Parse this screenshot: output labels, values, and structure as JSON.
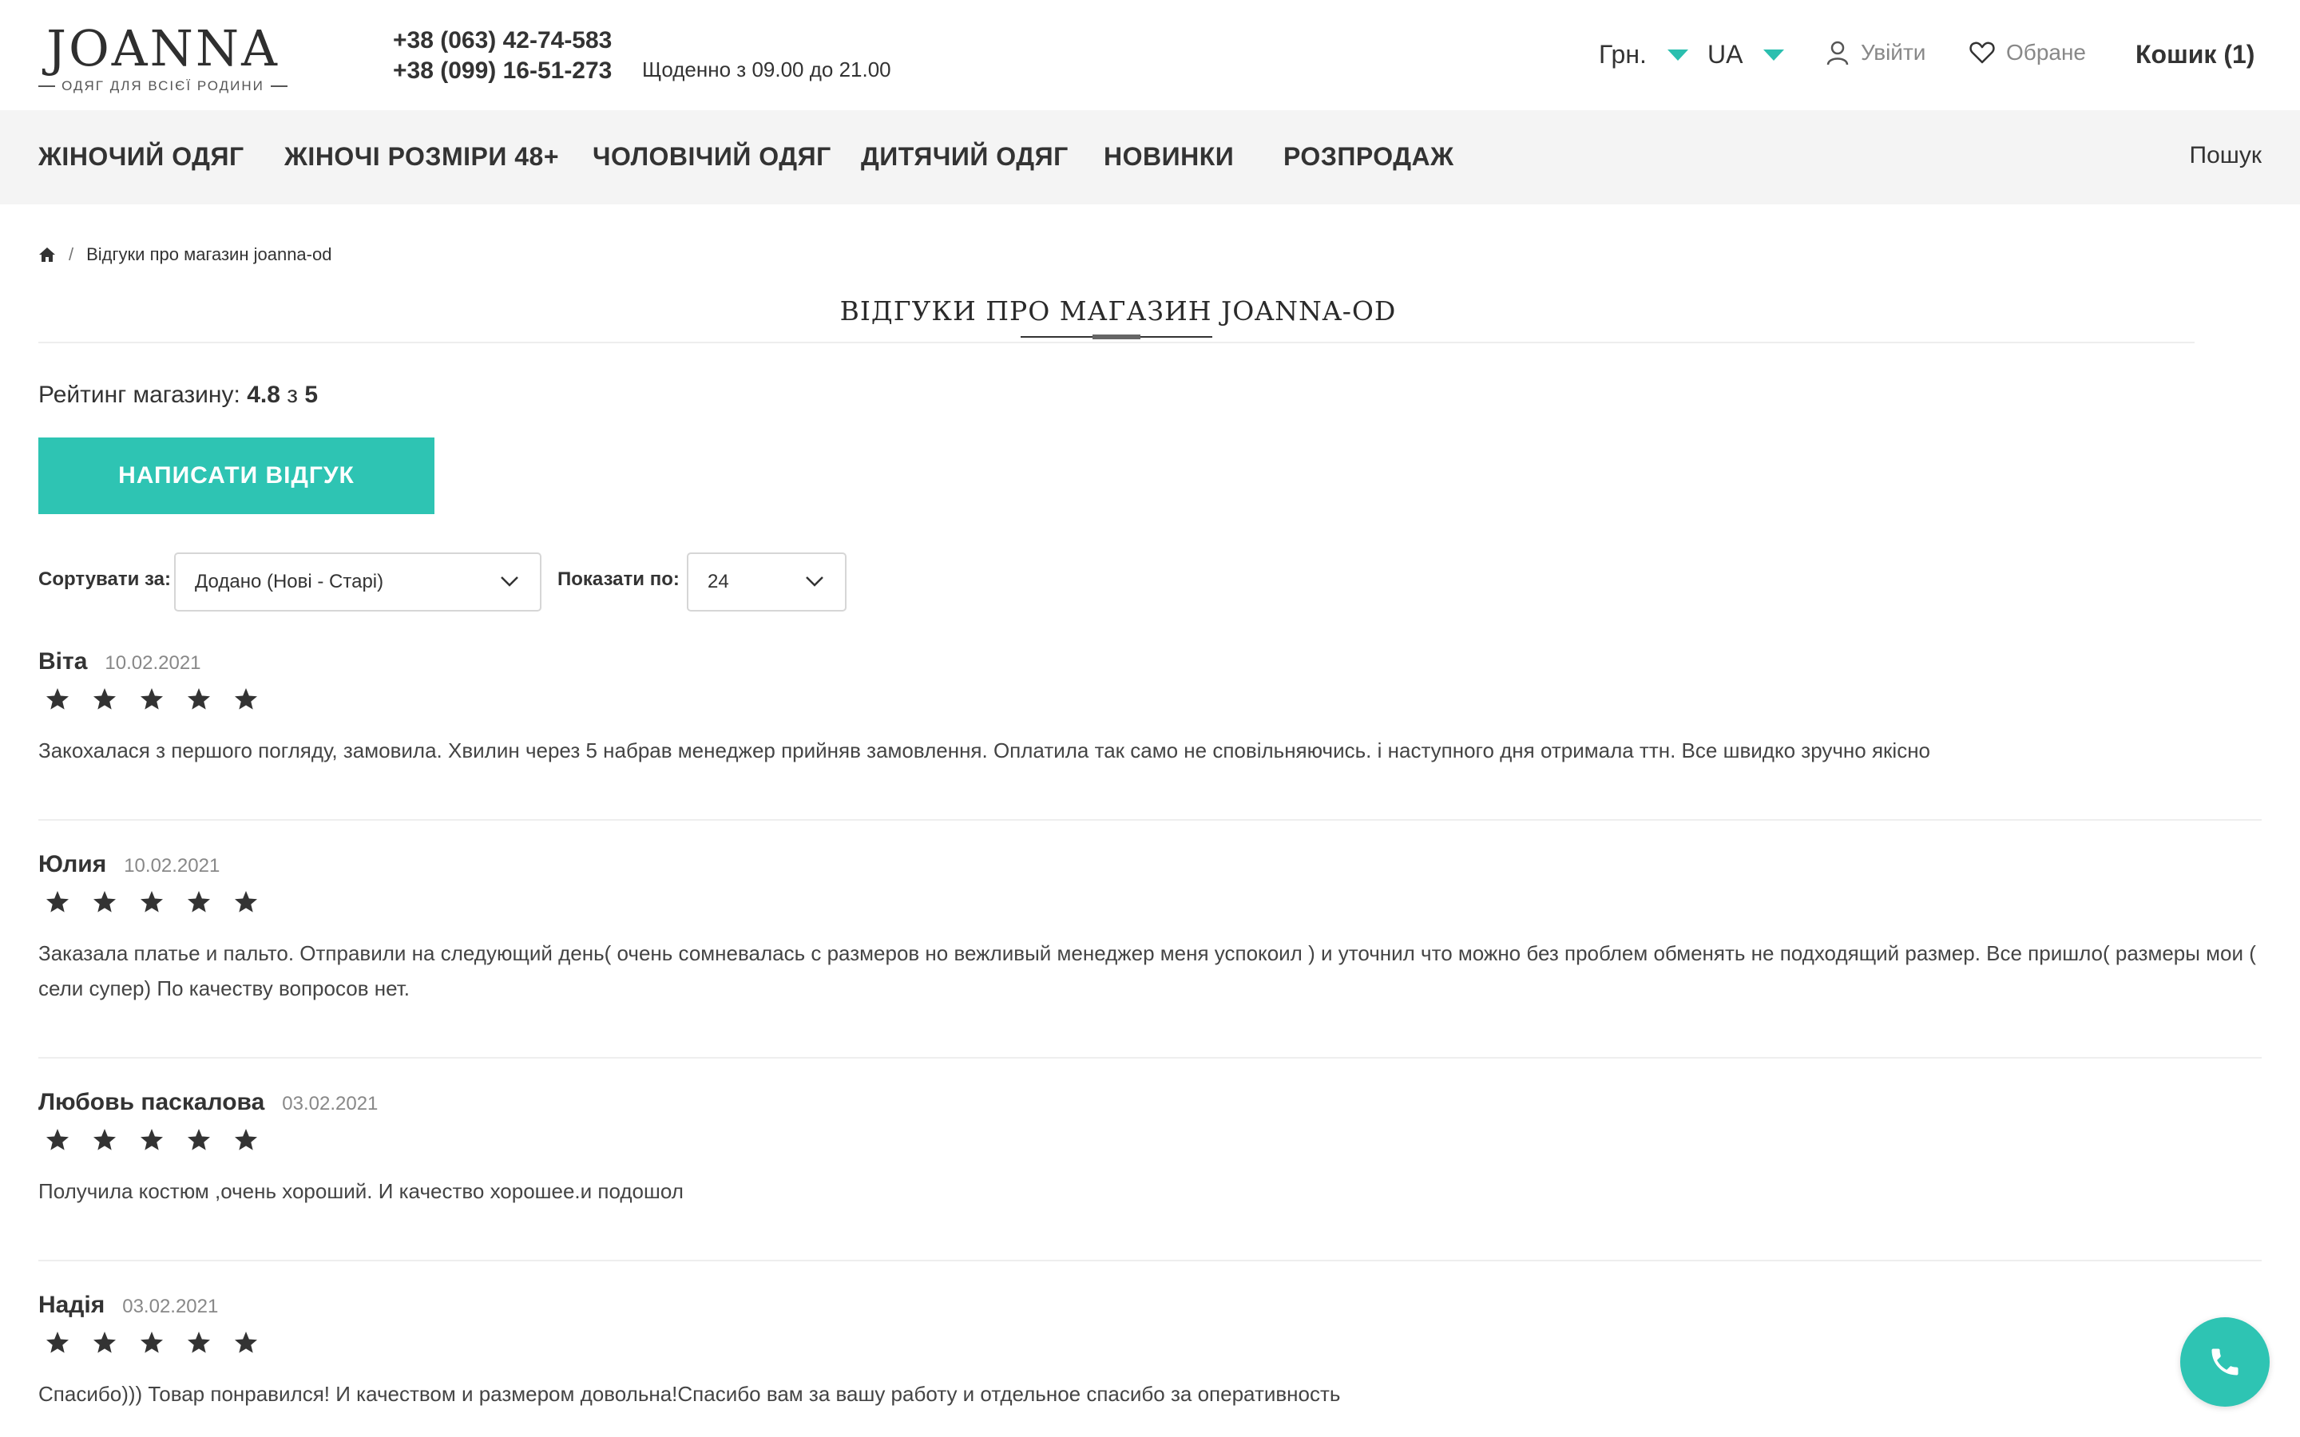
{
  "header": {
    "logo_name": "JOANNA",
    "logo_tagline": "ОДЯГ ДЛЯ ВСІЄЇ РОДИНИ",
    "phone1": "+38 (063) 42-74-583",
    "phone2": "+38 (099) 16-51-273",
    "hours": "Щоденно з 09.00 до 21.00",
    "currency": "Грн.",
    "language": "UA",
    "login": "Увійти",
    "favorites": "Обране",
    "cart": "Кошик (1)",
    "accent_color": "#2ec4b3"
  },
  "nav": {
    "items": [
      "ЖІНОЧИЙ ОДЯГ",
      "ЖІНОЧІ РОЗМІРИ 48+",
      "ЧОЛОВІЧИЙ ОДЯГ",
      "ДИТЯЧИЙ ОДЯГ",
      "НОВИНКИ",
      "РОЗПРОДАЖ"
    ],
    "search": "Пошук"
  },
  "breadcrumb": {
    "separator": "/",
    "current": "Відгуки про магазин joanna-od"
  },
  "page": {
    "title": "ВІДГУКИ ПРО МАГАЗИН JOANNA-OD",
    "rating_label": "Рейтинг магазину:",
    "rating_value": "4.8",
    "rating_of": "з",
    "rating_max": "5",
    "write_review": "НАПИСАТИ ВІДГУК"
  },
  "controls": {
    "sort_label": "Сортувати за:",
    "sort_value": "Додано (Нові - Старі)",
    "show_label": "Показати по:",
    "show_value": "24"
  },
  "reviews": [
    {
      "name": "Віта",
      "date": "10.02.2021",
      "stars": 5,
      "text": "Закохалася з першого погляду, замовила. Хвилин через 5 набрав менеджер прийняв замовлення. Оплатила так само не сповільняючись. і наступного дня отримала ттн. Все швидко зручно якісно"
    },
    {
      "name": "Юлия",
      "date": "10.02.2021",
      "stars": 5,
      "text": "Заказала платье и пальто. Отправили на следующий день( очень сомневалась с размеров но вежливый менеджер меня успокоил ) и уточнил что можно без проблем обменять не подходящий размер. Все пришло( размеры мои ( сели супер) По качеству вопросов нет."
    },
    {
      "name": "Любовь паскалова",
      "date": "03.02.2021",
      "stars": 5,
      "text": "Получила костюм ,очень хороший. И качество хорошее.и подошол"
    },
    {
      "name": "Надія",
      "date": "03.02.2021",
      "stars": 5,
      "text": "Спасибо))) Товар понравился! И качеством и размером довольна!Спасибо вам за вашу работу и отдельное спасибо за оперативность"
    }
  ]
}
